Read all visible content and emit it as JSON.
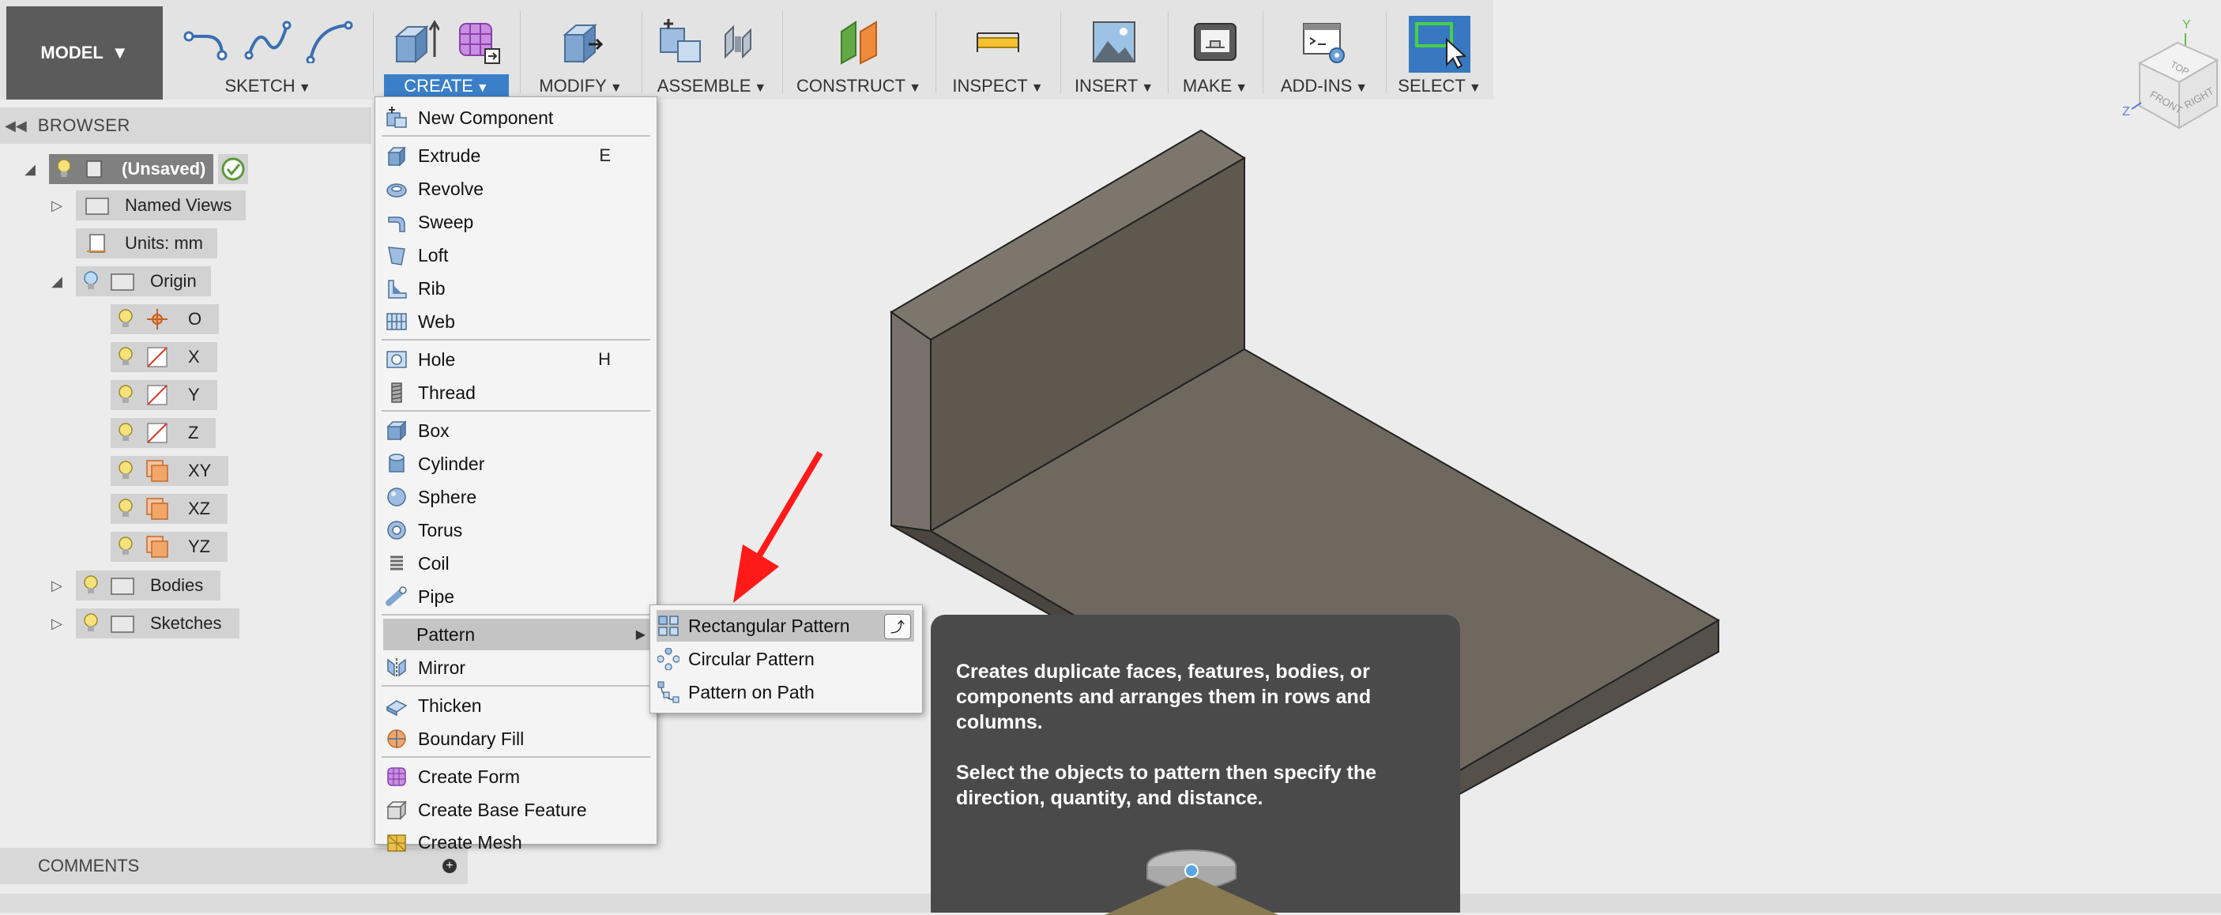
{
  "toolbar": {
    "model_label": "MODEL",
    "groups": [
      {
        "label": "SKETCH"
      },
      {
        "label": "CREATE"
      },
      {
        "label": "MODIFY"
      },
      {
        "label": "ASSEMBLE"
      },
      {
        "label": "CONSTRUCT"
      },
      {
        "label": "INSPECT"
      },
      {
        "label": "INSERT"
      },
      {
        "label": "MAKE"
      },
      {
        "label": "ADD-INS"
      },
      {
        "label": "SELECT"
      }
    ]
  },
  "viewcube": {
    "top": "TOP",
    "front": "FRONT",
    "right": "RIGHT",
    "axis_y": "Y",
    "axis_z": "Z"
  },
  "browser": {
    "title": "BROWSER",
    "root": "(Unsaved)",
    "items": [
      "Named Views",
      "Units: mm",
      "Origin",
      "O",
      "X",
      "Y",
      "Z",
      "XY",
      "XZ",
      "YZ",
      "Bodies",
      "Sketches"
    ]
  },
  "comments": {
    "title": "COMMENTS"
  },
  "create_menu": {
    "items": [
      {
        "label": "New Component"
      },
      {
        "label": "Extrude",
        "shortcut": "E"
      },
      {
        "label": "Revolve"
      },
      {
        "label": "Sweep"
      },
      {
        "label": "Loft"
      },
      {
        "label": "Rib"
      },
      {
        "label": "Web"
      },
      {
        "label": "Hole",
        "shortcut": "H"
      },
      {
        "label": "Thread"
      },
      {
        "label": "Box"
      },
      {
        "label": "Cylinder"
      },
      {
        "label": "Sphere"
      },
      {
        "label": "Torus"
      },
      {
        "label": "Coil"
      },
      {
        "label": "Pipe"
      },
      {
        "label": "Pattern"
      },
      {
        "label": "Mirror"
      },
      {
        "label": "Thicken"
      },
      {
        "label": "Boundary Fill"
      },
      {
        "label": "Create Form"
      },
      {
        "label": "Create Base Feature"
      },
      {
        "label": "Create Mesh"
      }
    ]
  },
  "pattern_submenu": {
    "items": [
      {
        "label": "Rectangular Pattern"
      },
      {
        "label": "Circular Pattern"
      },
      {
        "label": "Pattern on Path"
      }
    ]
  },
  "tooltip": {
    "line1": "Creates duplicate faces, features, bodies, or components and arranges them in rows and columns.",
    "line2": "Select the objects to pattern then specify the direction, quantity, and distance."
  },
  "colors": {
    "accent": "#3a7fc8",
    "toolbar": "#e3e3e3",
    "tooltip_bg": "#4a4a4a",
    "model_face": "#6b655c",
    "arrow": "#ff1a1a"
  }
}
